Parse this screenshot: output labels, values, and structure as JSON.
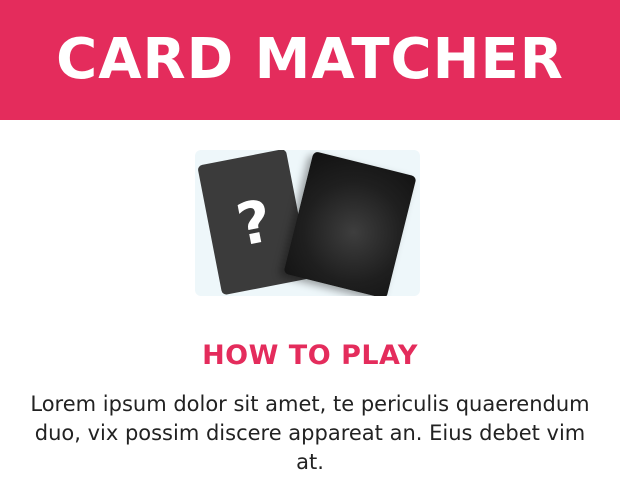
{
  "header": {
    "title": "CARD MATCHER"
  },
  "illustration": {
    "card_back_symbol": "?",
    "icons": [
      "question-card-icon",
      "face-down-card-icon"
    ]
  },
  "instructions": {
    "heading": "HOW TO PLAY",
    "body": "Lorem ipsum dolor sit amet, te periculis quaerendum duo, vix possim discere appareat an. Eius debet vim at."
  },
  "colors": {
    "accent": "#e42c5c",
    "card_back": "#3b3b3b",
    "card_front": "#1f1f1f",
    "illustration_bg": "#eef7fa"
  }
}
